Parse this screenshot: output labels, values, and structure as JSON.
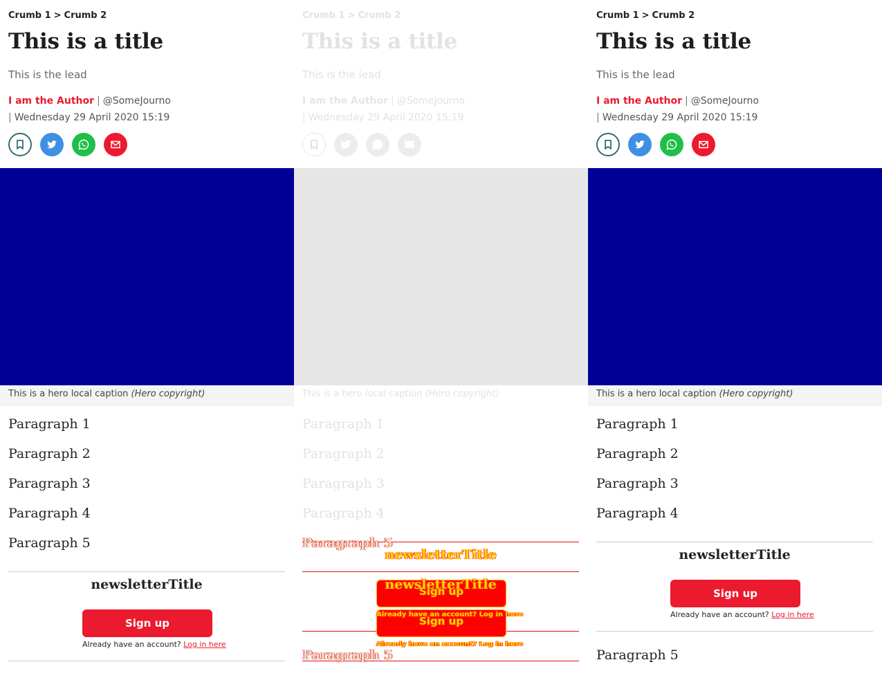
{
  "article": {
    "breadcrumb": [
      "Crumb 1",
      "Crumb 2"
    ],
    "breadcrumb_separator": ">",
    "title": "This is a title",
    "lead": "This is the lead",
    "author": "I am the Author",
    "author_handle": "@SomeJourno",
    "byline_separator": "|",
    "date": "Wednesday 29 April 2020 15:19",
    "share": [
      "bookmark-icon",
      "twitter-icon",
      "whatsapp-icon",
      "email-icon"
    ],
    "hero_color": "#000096",
    "hero_caption": "This is a hero local caption",
    "hero_copyright": "(Hero copyright)",
    "paragraphs": [
      "Paragraph 1",
      "Paragraph 2",
      "Paragraph 3",
      "Paragraph 4",
      "Paragraph 5"
    ]
  },
  "newsletter": {
    "title": "newsletterTitle",
    "signup_label": "Sign up",
    "already_text": "Already have an account?",
    "login_link": "Log in here"
  },
  "colors": {
    "accent": "#ec1a2e",
    "twitter": "#3f8fe3",
    "whatsapp": "#1fbf48",
    "bookmark_border": "#2f6e73"
  }
}
